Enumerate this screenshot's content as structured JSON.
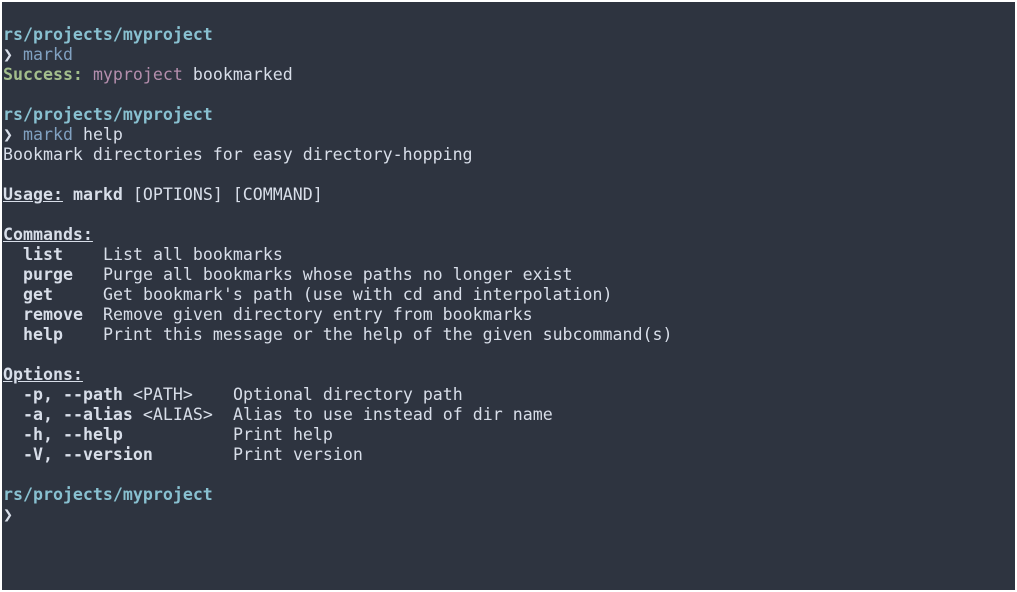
{
  "blocks": [
    {
      "path": "rs/projects/myproject",
      "prompt_symbol": "❯",
      "command": "markd",
      "success_label": "Success:",
      "success_project": "myproject",
      "success_text": "bookmarked"
    },
    {
      "path": "rs/projects/myproject",
      "prompt_symbol": "❯",
      "command": "markd",
      "command_arg": "help"
    },
    {
      "path": "rs/projects/myproject",
      "prompt_symbol": "❯"
    }
  ],
  "help": {
    "description": "Bookmark directories for easy directory-hopping",
    "usage_label": "Usage:",
    "usage_bin": "markd",
    "usage_args": "[OPTIONS] [COMMAND]",
    "commands_label": "Commands:",
    "commands": [
      {
        "name": "list",
        "desc": "List all bookmarks"
      },
      {
        "name": "purge",
        "desc": "Purge all bookmarks whose paths no longer exist"
      },
      {
        "name": "get",
        "desc": "Get bookmark's path (use with cd and interpolation)"
      },
      {
        "name": "remove",
        "desc": "Remove given directory entry from bookmarks"
      },
      {
        "name": "help",
        "desc": "Print this message or the help of the given subcommand(s)"
      }
    ],
    "options_label": "Options:",
    "options": [
      {
        "short": "-p,",
        "long": "--path",
        "arg": "<PATH>",
        "desc": "Optional directory path"
      },
      {
        "short": "-a,",
        "long": "--alias",
        "arg": "<ALIAS>",
        "desc": "Alias to use instead of dir name"
      },
      {
        "short": "-h,",
        "long": "--help",
        "arg": "",
        "desc": "Print help"
      },
      {
        "short": "-V,",
        "long": "--version",
        "arg": "",
        "desc": "Print version"
      }
    ]
  },
  "colors": {
    "background": "#2e3440",
    "path": "#88c0d0",
    "command": "#81a1c1",
    "success": "#a3be8c",
    "project": "#b48ead",
    "text": "#d8dee9"
  }
}
